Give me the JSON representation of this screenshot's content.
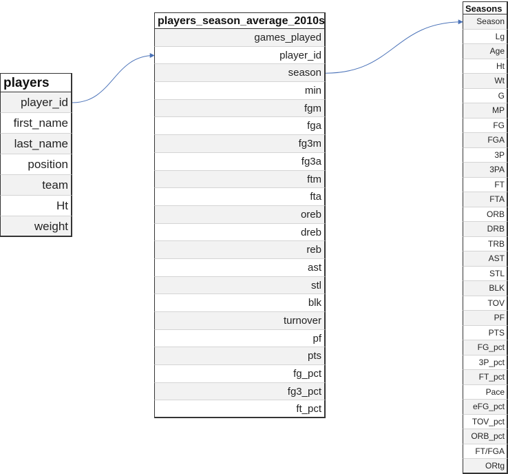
{
  "tables": {
    "players": {
      "title": "players",
      "fields": [
        "player_id",
        "first_name",
        "last_name",
        "position",
        "team",
        "Ht",
        "weight"
      ]
    },
    "season_avg": {
      "title": "players_season_average_2010s",
      "fields": [
        "games_played",
        "player_id",
        "season",
        "min",
        "fgm",
        "fga",
        "fg3m",
        "fg3a",
        "ftm",
        "fta",
        "oreb",
        "dreb",
        "reb",
        "ast",
        "stl",
        "blk",
        "turnover",
        "pf",
        "pts",
        "fg_pct",
        "fg3_pct",
        "ft_pct"
      ]
    },
    "seasons": {
      "title": "Seasons",
      "fields": [
        "Season",
        "Lg",
        "Age",
        "Ht",
        "Wt",
        "G",
        "MP",
        "FG",
        "FGA",
        "3P",
        "3PA",
        "FT",
        "FTA",
        "ORB",
        "DRB",
        "TRB",
        "AST",
        "STL",
        "BLK",
        "TOV",
        "PF",
        "PTS",
        "FG_pct",
        "3P_pct",
        "FT_pct",
        "Pace",
        "eFG_pct",
        "TOV_pct",
        "ORB_pct",
        "FT/FGA",
        "ORtg"
      ]
    }
  },
  "links": [
    {
      "from_table": "players",
      "from_field": "player_id",
      "to_table": "season_avg",
      "to_field": "player_id"
    },
    {
      "from_table": "season_avg",
      "from_field": "season",
      "to_table": "seasons",
      "to_field": "Season"
    }
  ],
  "colors": {
    "link": "#4a72b8",
    "header_border": "#333333",
    "alt_row": "#f2f2f2"
  }
}
